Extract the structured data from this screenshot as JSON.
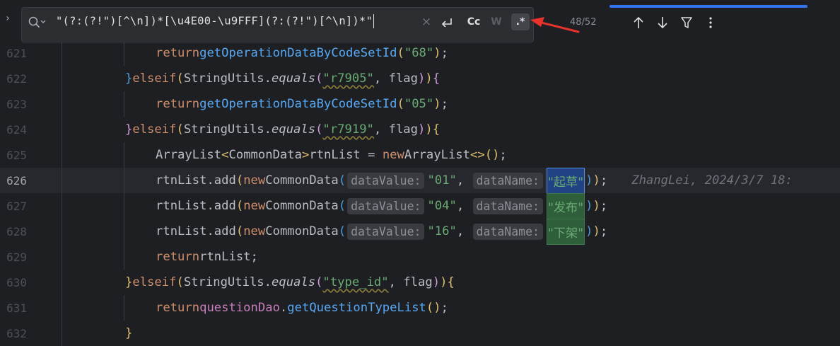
{
  "search": {
    "query": "\"(?:(?!\")[^\\n])*[\\u4E00-\\u9FFF](?:(?!\")[^\\n])*\"",
    "clear_label": "×",
    "case_label": "Cc",
    "word_label": "W",
    "regex_label": ".*",
    "match_count": "48/52",
    "expand_label": "›"
  },
  "lines": [
    {
      "num": "621"
    },
    {
      "num": "622"
    },
    {
      "num": "623"
    },
    {
      "num": "624"
    },
    {
      "num": "625"
    },
    {
      "num": "626"
    },
    {
      "num": "627"
    },
    {
      "num": "628"
    },
    {
      "num": "629"
    },
    {
      "num": "630"
    },
    {
      "num": "631"
    },
    {
      "num": "632"
    }
  ],
  "code": {
    "l621": {
      "kw": "return",
      "fn": "getOperationDataByCodeSetId",
      "arg": "\"68\""
    },
    "l622": {
      "brace_close": "}",
      "else": "else",
      "if": "if",
      "cls": "StringUtils",
      "method": "equals",
      "arg1": "\"r7905\"",
      "arg2": "flag"
    },
    "l623": {
      "kw": "return",
      "fn": "getOperationDataByCodeSetId",
      "arg": "\"05\""
    },
    "l624": {
      "brace_close": "}",
      "else": "else",
      "if": "if",
      "cls": "StringUtils",
      "method": "equals",
      "arg1": "\"r7919\"",
      "arg2": "flag"
    },
    "l625": {
      "type": "ArrayList",
      "generic": "CommonData",
      "var": "rtnList",
      "new": "new",
      "ctor": "ArrayList"
    },
    "l626": {
      "obj": "rtnList",
      "method": "add",
      "new": "new",
      "ctor": "CommonData",
      "hint1": "dataValue:",
      "val": "\"01\"",
      "hint2": "dataName:",
      "name": "\"起草\"",
      "blame": "ZhangLei, 2024/3/7 18:"
    },
    "l627": {
      "obj": "rtnList",
      "method": "add",
      "new": "new",
      "ctor": "CommonData",
      "hint1": "dataValue:",
      "val": "\"04\"",
      "hint2": "dataName:",
      "name": "\"发布\""
    },
    "l628": {
      "obj": "rtnList",
      "method": "add",
      "new": "new",
      "ctor": "CommonData",
      "hint1": "dataValue:",
      "val": "\"16\"",
      "hint2": "dataName:",
      "name": "\"下架\""
    },
    "l629": {
      "kw": "return",
      "var": "rtnList"
    },
    "l630": {
      "brace_close": "}",
      "else": "else",
      "if": "if",
      "cls": "StringUtils",
      "method": "equals",
      "arg1": "\"type_id\"",
      "arg2": "flag"
    },
    "l631": {
      "kw": "return",
      "field": "questionDao",
      "method": "getQuestionTypeList"
    },
    "l632": {
      "brace_close": "}"
    }
  },
  "colors": {
    "background": "#1e1f22",
    "keyword": "#cf8e6d",
    "string": "#6aab73",
    "function": "#56a8f5",
    "field": "#c77dbb",
    "match_highlight": "#2e5e3a",
    "selected_match": "#214283",
    "annotation_arrow": "#e8322b"
  }
}
